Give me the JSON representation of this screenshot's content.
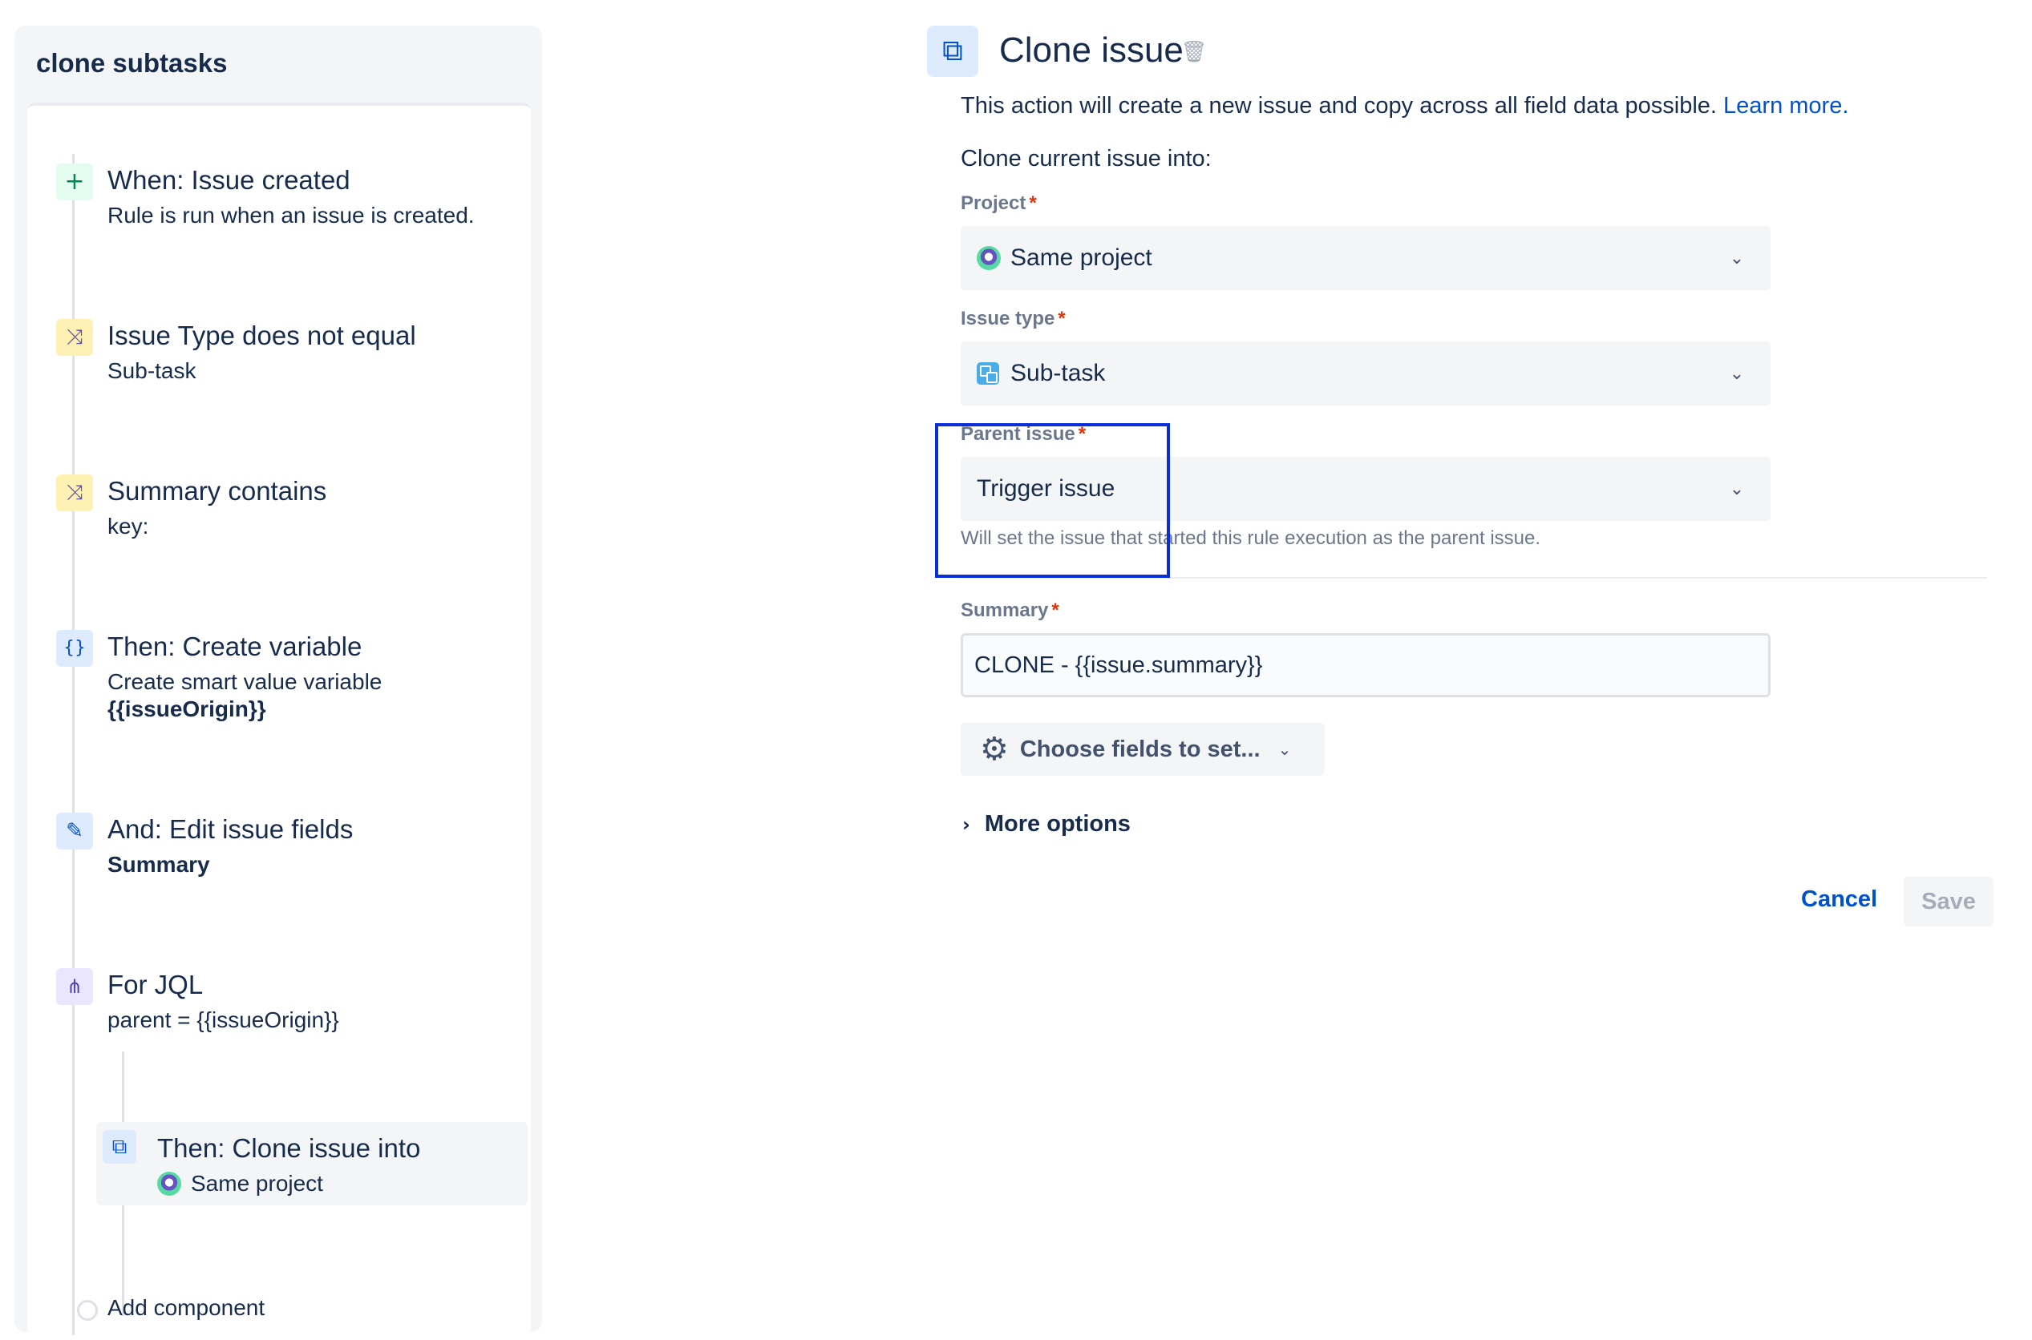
{
  "rule": {
    "title": "clone subtasks",
    "steps": [
      {
        "title": "When: Issue created",
        "subtitle": "Rule is run when an issue is created."
      },
      {
        "title": "Issue Type does not equal",
        "subtitle": "Sub-task"
      },
      {
        "title": "Summary contains",
        "subtitle": "key:"
      },
      {
        "title": "Then: Create variable",
        "subtitle": "Create smart value variable",
        "subtitle_bold": "{{issueOrigin}}"
      },
      {
        "title": "And: Edit issue fields",
        "subtitle_bold": "Summary"
      },
      {
        "title": "For JQL",
        "subtitle": "parent = {{issueOrigin}}"
      }
    ],
    "nested_step": {
      "title": "Then: Clone issue into",
      "subtitle": "Same project"
    },
    "add_component": "Add component"
  },
  "config": {
    "title": "Clone issue",
    "description": "This action will create a new issue and copy across all field data possible.",
    "learn_more": "Learn more.",
    "clone_into": "Clone current issue into:",
    "project": {
      "label": "Project",
      "required": "*",
      "value": "Same project"
    },
    "issue_type": {
      "label": "Issue type",
      "required": "*",
      "value": "Sub-task"
    },
    "parent_issue": {
      "label": "Parent issue",
      "required": "*",
      "value": "Trigger issue",
      "help": "Will set the issue that started this rule execution as the parent issue."
    },
    "summary": {
      "label": "Summary",
      "required": "*",
      "value": "CLONE - {{issue.summary}}"
    },
    "choose_fields": "Choose fields to set...",
    "more_options": "More options",
    "cancel": "Cancel",
    "save": "Save"
  },
  "colors": {
    "accent": "#0052cc",
    "highlight_box": "#0a2fd6",
    "required": "#de350b"
  },
  "icons": {
    "trigger": "plus-icon",
    "condition": "shuffle-icon",
    "variable": "braces-icon",
    "edit": "pencil-icon",
    "branch": "hierarchy-icon",
    "clone": "copy-icon",
    "delete": "trash-icon",
    "settings": "gear-icon"
  }
}
